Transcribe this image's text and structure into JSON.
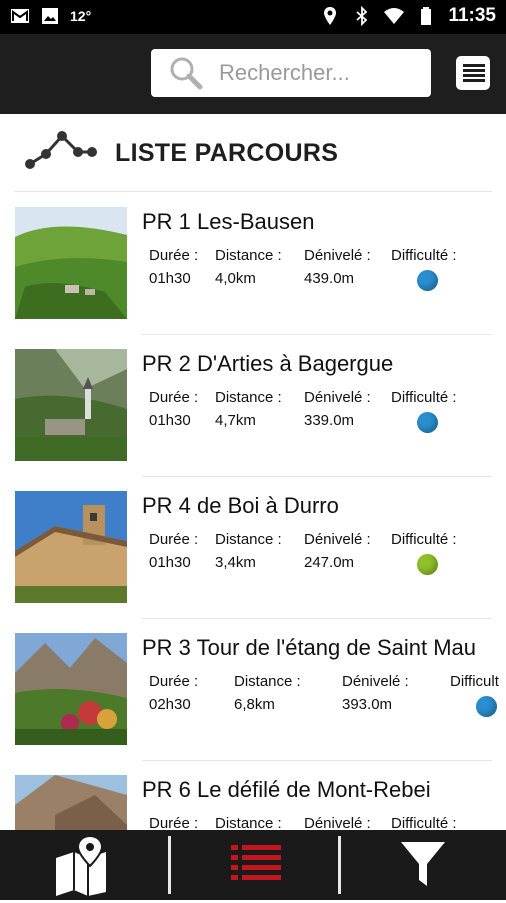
{
  "status_bar": {
    "temperature": "12°",
    "time": "11:35",
    "icons": [
      "gmail-icon",
      "image-icon",
      "location-icon",
      "bluetooth-icon",
      "wifi-icon",
      "battery-icon"
    ]
  },
  "app_bar": {
    "search_placeholder": "Rechercher...",
    "icons": [
      "search-icon",
      "menu-icon"
    ]
  },
  "header": {
    "title": "LISTE PARCOURS",
    "icon": "route-icon"
  },
  "labels": {
    "duration": "Durée :",
    "distance": "Distance :",
    "elevation": "Dénivelé :",
    "difficulty": "Difficulté :"
  },
  "colors": {
    "difficulty_blue": "#2a8fd0",
    "difficulty_green": "#8fc12a",
    "active_nav": "#c4161c"
  },
  "routes": [
    {
      "name": "PR 1 Les-Bausen",
      "duration": "01h30",
      "distance": "4,0km",
      "elevation": "439.0m",
      "difficulty_color": "#2a8fd0"
    },
    {
      "name": "PR 2 D'Arties à Bagergue",
      "duration": "01h30",
      "distance": "4,7km",
      "elevation": "339.0m",
      "difficulty_color": "#2a8fd0"
    },
    {
      "name": "PR 4 de Boi à Durro",
      "duration": "01h30",
      "distance": "3,4km",
      "elevation": "247.0m",
      "difficulty_color": "#8fc12a"
    },
    {
      "name": "PR 3 Tour de l'étang de Saint Mau",
      "duration": "02h30",
      "distance": "6,8km",
      "elevation": "393.0m",
      "difficulty_color": "#2a8fd0",
      "difficulty_label": "Difficult"
    },
    {
      "name": "PR 6 Le défilé de Mont-Rebei",
      "duration": "",
      "distance": "",
      "elevation": "",
      "difficulty_color": ""
    }
  ],
  "bottom_nav": {
    "items": [
      "map-icon",
      "list-icon",
      "filter-icon"
    ],
    "active": "list-icon"
  }
}
